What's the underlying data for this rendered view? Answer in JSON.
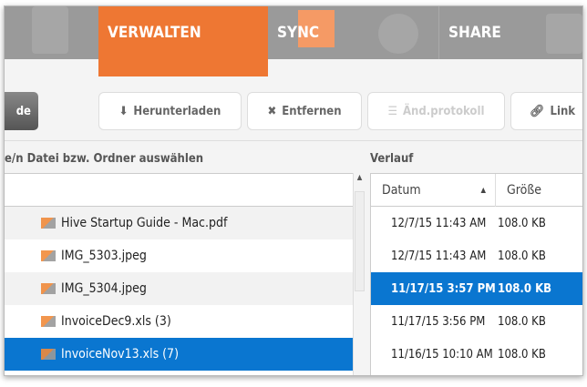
{
  "tabs": {
    "manage": "VERWALTEN",
    "sync": "SYNC",
    "share": "SHARE"
  },
  "toolbar": {
    "dark_button": "de",
    "download": "Herunterladen",
    "remove": "Entfernen",
    "changelog": "Änd.protokoll",
    "link": "Link"
  },
  "files": {
    "header": "e/n Datei bzw. Ordner auswählen",
    "items": [
      "Hive Startup Guide - Mac.pdf",
      "IMG_5303.jpeg",
      "IMG_5304.jpeg",
      "InvoiceDec9.xls (3)",
      "InvoiceNov13.xls (7)"
    ]
  },
  "history": {
    "header": "Verlauf",
    "col_date": "Datum",
    "col_size": "Größe",
    "sort_icon": "▲",
    "rows": [
      {
        "date": "12/7/15 11:43 AM",
        "size": "108.0 KB"
      },
      {
        "date": "12/7/15 11:43 AM",
        "size": "108.0 KB"
      },
      {
        "date": "11/17/15 3:57 PM",
        "size": "108.0 KB"
      },
      {
        "date": "11/17/15 3:56 PM",
        "size": "108.0 KB"
      },
      {
        "date": "11/16/15 10:10 AM",
        "size": "108.0 KB"
      }
    ]
  },
  "colors": {
    "accent": "#ee7733",
    "selection": "#0a76d0"
  }
}
